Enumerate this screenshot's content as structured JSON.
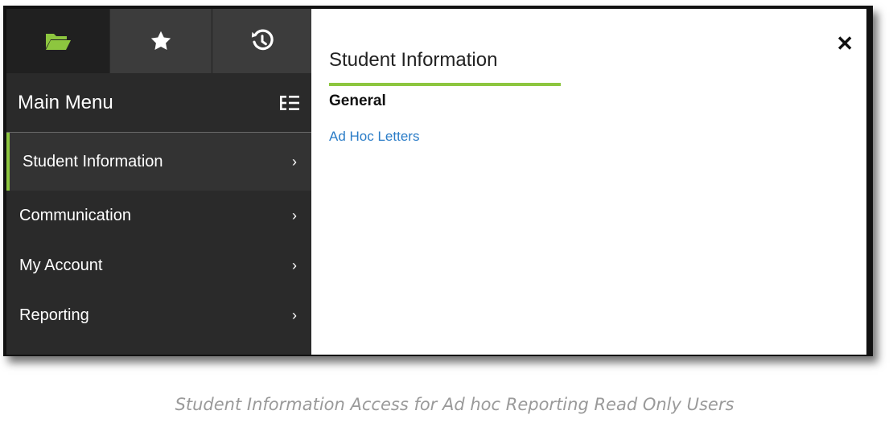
{
  "tabs": [
    {
      "icon": "folder-open-icon",
      "active": true
    },
    {
      "icon": "star-icon",
      "active": false
    },
    {
      "icon": "history-icon",
      "active": false
    }
  ],
  "sidebar": {
    "title": "Main Menu",
    "items": [
      {
        "label": "Student Information",
        "active": true
      },
      {
        "label": "Communication",
        "active": false
      },
      {
        "label": "My Account",
        "active": false
      },
      {
        "label": "Reporting",
        "active": false
      }
    ]
  },
  "panel": {
    "title": "Student Information",
    "section": "General",
    "link": "Ad Hoc Letters"
  },
  "caption": "Student Information Access for Ad hoc Reporting Read Only Users",
  "colors": {
    "accent": "#8dc63f",
    "link": "#2a7cc7",
    "sidebar_bg": "#2a2a2a"
  }
}
